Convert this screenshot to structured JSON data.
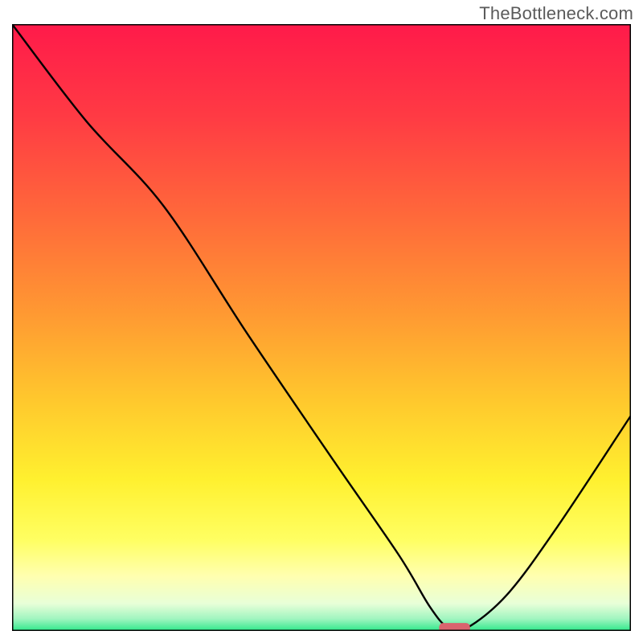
{
  "watermark": "TheBottleneck.com",
  "chart_data": {
    "type": "line",
    "title": "",
    "xlabel": "",
    "ylabel": "",
    "xlim": [
      0,
      100
    ],
    "ylim": [
      0,
      100
    ],
    "gradient_stops": [
      {
        "offset": 0.0,
        "color": "#ff1a4a"
      },
      {
        "offset": 0.15,
        "color": "#ff3a44"
      },
      {
        "offset": 0.32,
        "color": "#ff6a3a"
      },
      {
        "offset": 0.48,
        "color": "#ff9a32"
      },
      {
        "offset": 0.62,
        "color": "#ffc82d"
      },
      {
        "offset": 0.75,
        "color": "#fff02f"
      },
      {
        "offset": 0.85,
        "color": "#ffff62"
      },
      {
        "offset": 0.91,
        "color": "#ffffb0"
      },
      {
        "offset": 0.955,
        "color": "#e8ffd8"
      },
      {
        "offset": 0.98,
        "color": "#a0f5c0"
      },
      {
        "offset": 1.0,
        "color": "#2ee88a"
      }
    ],
    "series": [
      {
        "name": "curve",
        "x": [
          0.0,
          12.0,
          24.5,
          38.0,
          52.0,
          62.5,
          67.5,
          70.5,
          73.5,
          80.0,
          88.0,
          100.0
        ],
        "y": [
          100.0,
          84.0,
          70.0,
          49.0,
          28.0,
          12.5,
          4.0,
          0.5,
          0.5,
          6.0,
          17.0,
          35.5
        ]
      }
    ],
    "marker": {
      "shape": "rounded-rect",
      "x": 71.5,
      "y": 0.5,
      "width": 5.0,
      "height": 1.6,
      "color": "#d9646e"
    },
    "frame": true
  }
}
